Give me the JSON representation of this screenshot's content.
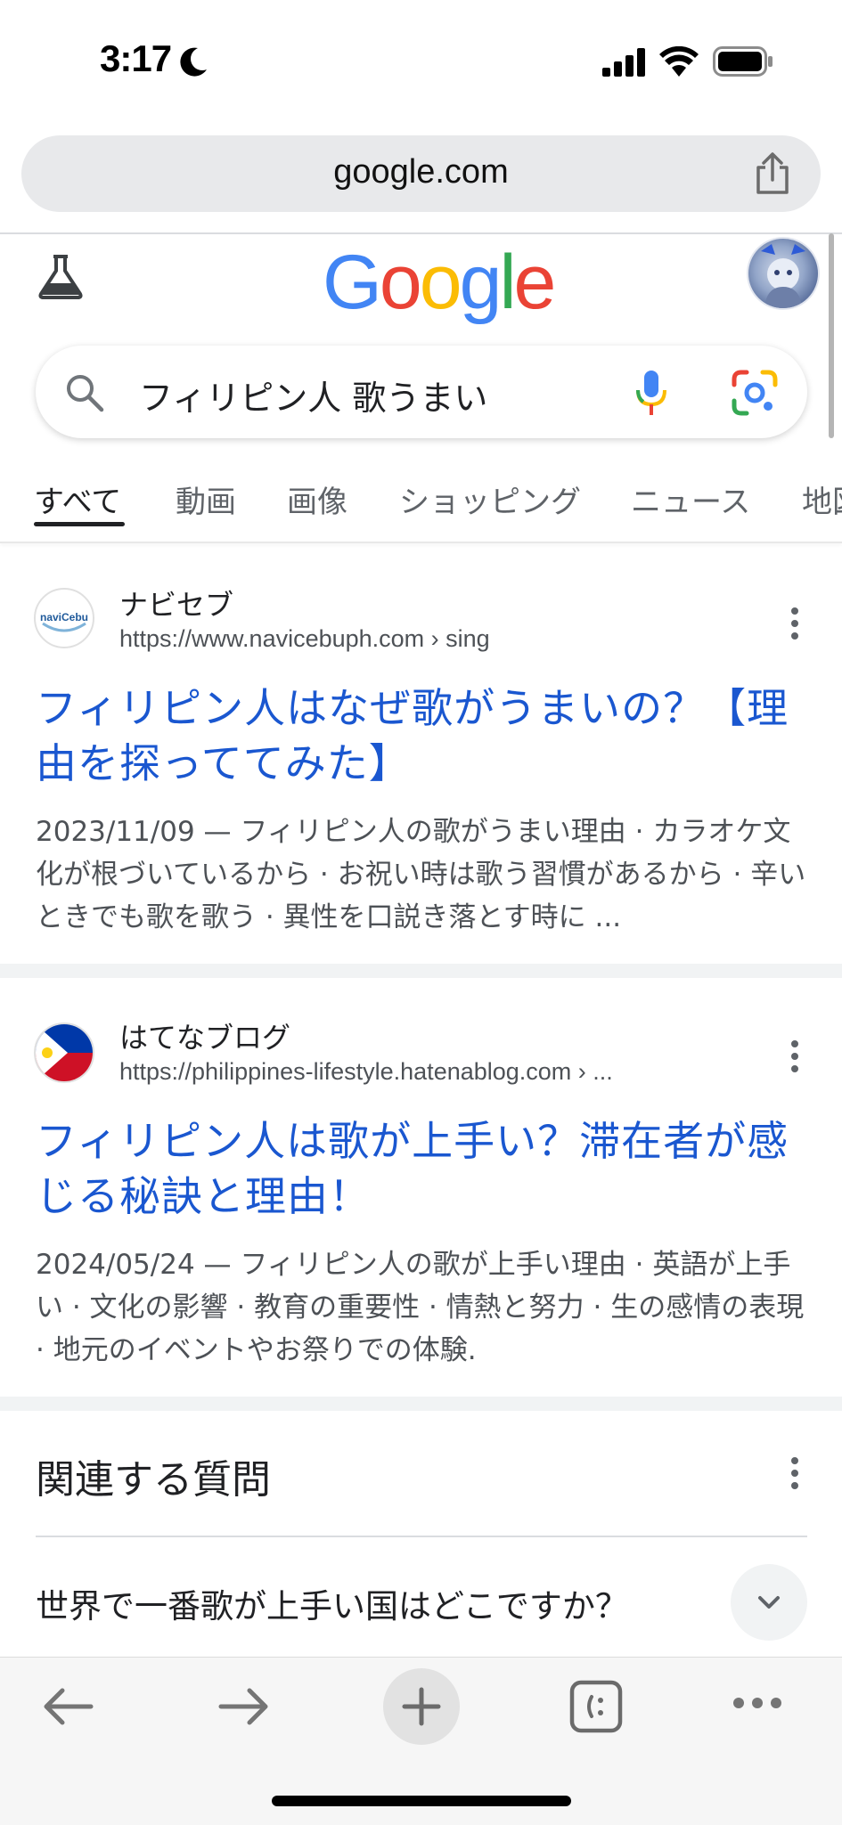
{
  "status_bar": {
    "time": "3:17"
  },
  "browser": {
    "url": "google.com"
  },
  "google_logo": {
    "letters": [
      "G",
      "o",
      "o",
      "g",
      "l",
      "e"
    ],
    "colors": [
      "#4285F4",
      "#EA4335",
      "#FBBC05",
      "#4285F4",
      "#34A853",
      "#EA4335"
    ]
  },
  "search": {
    "query": "フィリピン人 歌うまい"
  },
  "tabs": [
    {
      "label": "すべて"
    },
    {
      "label": "動画"
    },
    {
      "label": "画像"
    },
    {
      "label": "ショッピング"
    },
    {
      "label": "ニュース"
    },
    {
      "label": "地図"
    }
  ],
  "results": [
    {
      "site": "ナビセブ",
      "url": "https://www.navicebuph.com",
      "path": " › sing",
      "favicon_text": "naviCebu",
      "title": "フィリピン人はなぜ歌がうまいの？【理由を探っててみた】",
      "date": "2023/11/09",
      "snippet": "フィリピン人の歌がうまい理由 · カラオケ文化が根づいているから · お祝い時は歌う習慣があるから · 辛いときでも歌を歌う · 異性を口説き落とす時に ..."
    },
    {
      "site": "はてなブログ",
      "url": "https://philippines-lifestyle.hatenablog.com",
      "path": " › ...",
      "title": "フィリピン人は歌が上手い？滞在者が感じる秘訣と理由！",
      "date": "2024/05/24",
      "snippet": "フィリピン人の歌が上手い理由 · 英語が上手い · 文化の影響 · 教育の重要性 · 情熱と努力 · 生の感情の表現 · 地元のイベントやお祭りでの体験."
    }
  ],
  "related_questions": {
    "title": "関連する質問",
    "items": [
      "世界で一番歌が上手い国はどこですか？"
    ]
  },
  "date_separator": " — ",
  "colors": {
    "link": "#1a57d0",
    "text": "#202124",
    "muted": "#4d5156"
  }
}
